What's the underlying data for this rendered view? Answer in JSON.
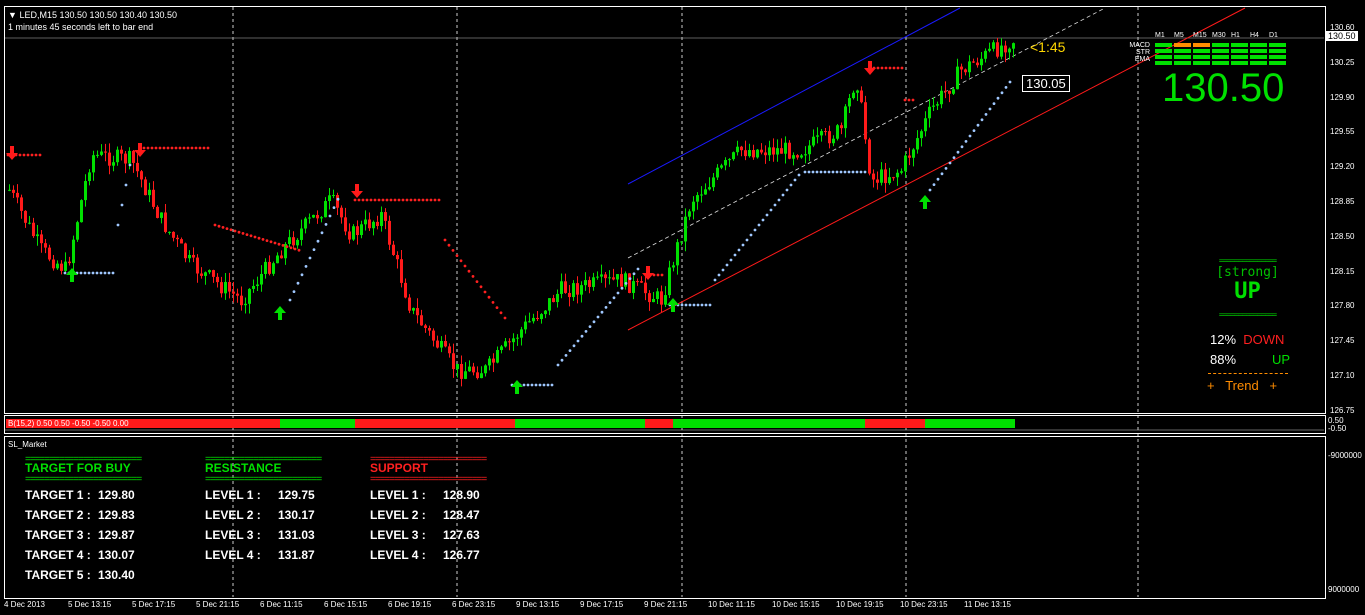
{
  "header": {
    "symbol_line": "LED,M15  130.50 130.50 130.40 130.50",
    "timer_line": "1 minutes 45 seconds left to bar end"
  },
  "price_axis": [
    "130.60",
    "130.25",
    "129.90",
    "129.55",
    "129.20",
    "128.85",
    "128.50",
    "128.15",
    "127.80",
    "127.45",
    "127.10",
    "126.75"
  ],
  "current_price_tag": "130.50",
  "countdown": "<1:45",
  "price_label": "130.05",
  "time_axis": [
    "4 Dec 2013",
    "5 Dec 13:15",
    "5 Dec 17:15",
    "5 Dec 21:15",
    "6 Dec 11:15",
    "6 Dec 15:15",
    "6 Dec 19:15",
    "6 Dec 23:15",
    "9 Dec 13:15",
    "9 Dec 17:15",
    "9 Dec 21:15",
    "10 Dec 11:15",
    "10 Dec 15:15",
    "10 Dec 19:15",
    "10 Dec 23:15",
    "11 Dec 13:15"
  ],
  "dashboard": {
    "timeframes": [
      "M1",
      "M5",
      "M15",
      "M30",
      "H1",
      "H4",
      "D1"
    ],
    "indicators": [
      "MACD",
      "STR",
      "EMA"
    ],
    "big_price": "130.50",
    "separator": "===============",
    "strength": "[strong]",
    "direction": "UP",
    "down_pct": "12%",
    "down_label": "DOWN",
    "up_pct": "88%",
    "up_label": "UP",
    "trend_label": "+   Trend   +",
    "colors": {
      "green": "#00e000",
      "red": "#ff2020",
      "orange": "#ff8c00"
    }
  },
  "histogram": {
    "label": "B(15,2) 0.50 0.50 -0.50 -0.50 0.00",
    "scale_right": "0.50",
    "scale_right2": "-0.50"
  },
  "subwindow": {
    "name": "SL_Market",
    "scale_top": "-9000000",
    "scale_bottom": "9000000",
    "separator": "========================",
    "buy": {
      "title": "TARGET FOR BUY",
      "rows": [
        {
          "label": "TARGET 1 :",
          "value": "129.80"
        },
        {
          "label": "TARGET 2 :",
          "value": "129.83"
        },
        {
          "label": "TARGET 3 :",
          "value": "129.87"
        },
        {
          "label": "TARGET 4 :",
          "value": "130.07"
        },
        {
          "label": "TARGET 5 :",
          "value": "130.40"
        }
      ]
    },
    "resistance": {
      "title": "RESISTANCE",
      "rows": [
        {
          "label": "LEVEL 1 :",
          "value": "129.75"
        },
        {
          "label": "LEVEL 2 :",
          "value": "130.17"
        },
        {
          "label": "LEVEL 3 :",
          "value": "131.03"
        },
        {
          "label": "LEVEL 4 :",
          "value": "131.87"
        }
      ]
    },
    "support": {
      "title": "SUPPORT",
      "rows": [
        {
          "label": "LEVEL 1 :",
          "value": "128.90"
        },
        {
          "label": "LEVEL 2 :",
          "value": "128.47"
        },
        {
          "label": "LEVEL 3 :",
          "value": "127.63"
        },
        {
          "label": "LEVEL 4 :",
          "value": "126.77"
        }
      ]
    }
  }
}
